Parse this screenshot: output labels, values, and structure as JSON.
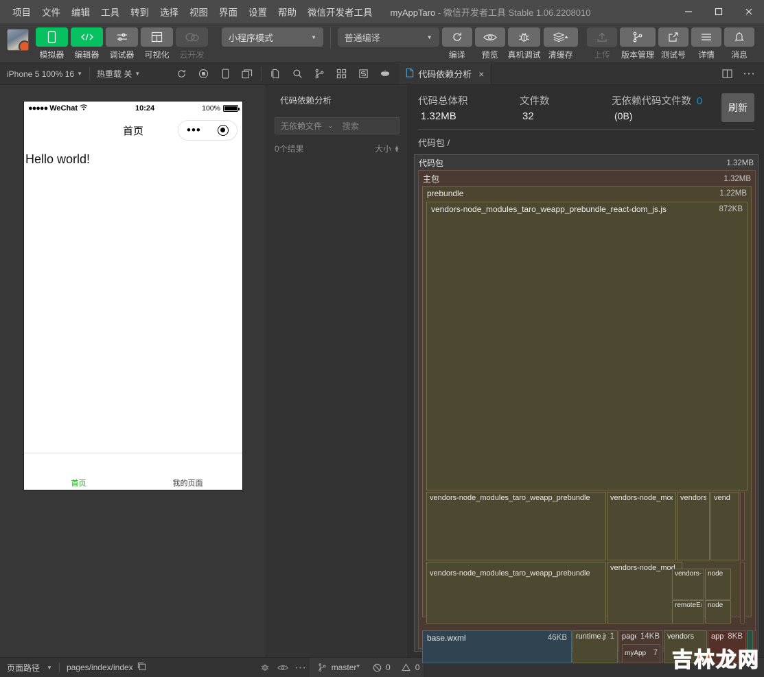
{
  "titlebar": {
    "menus": [
      "项目",
      "文件",
      "编辑",
      "工具",
      "转到",
      "选择",
      "视图",
      "界面",
      "设置",
      "帮助",
      "微信开发者工具"
    ],
    "project_name": "myAppTaro",
    "separator": "-",
    "app_name": "微信开发者工具",
    "version": "Stable 1.06.2208010",
    "window_controls": [
      "minimize-icon",
      "maximize-icon",
      "close-icon"
    ]
  },
  "toolbar": {
    "buttons": [
      {
        "label": "模拟器",
        "icon": "phone-icon",
        "state": "green"
      },
      {
        "label": "编辑器",
        "icon": "code-icon",
        "state": "green"
      },
      {
        "label": "调试器",
        "icon": "sliders-icon",
        "state": "normal"
      },
      {
        "label": "可视化",
        "icon": "layout-icon",
        "state": "normal"
      },
      {
        "label": "云开发",
        "icon": "cloud-icon",
        "state": "disabled"
      }
    ],
    "mode_select": "小程序模式",
    "compile_select": "普通编译",
    "actions": [
      {
        "label": "编译",
        "icon": "refresh-icon",
        "state": "normal"
      },
      {
        "label": "预览",
        "icon": "eye-icon",
        "state": "normal"
      },
      {
        "label": "真机调试",
        "icon": "bug-icon",
        "state": "normal"
      },
      {
        "label": "清缓存",
        "icon": "layers-icon",
        "state": "normal"
      },
      {
        "label": "上传",
        "icon": "upload-icon",
        "state": "disabled"
      },
      {
        "label": "版本管理",
        "icon": "branch-icon",
        "state": "normal"
      },
      {
        "label": "测试号",
        "icon": "external-link-icon",
        "state": "normal"
      },
      {
        "label": "详情",
        "icon": "menu-icon",
        "state": "normal"
      },
      {
        "label": "消息",
        "icon": "bell-icon",
        "state": "normal"
      }
    ]
  },
  "subbar": {
    "device": "iPhone 5 100% 16",
    "hot_reload": "热重载 关",
    "sim_icons": [
      "refresh-icon",
      "record-icon",
      "device-icon",
      "window-icon"
    ],
    "editor_icons": [
      "new-file-icon",
      "search-icon",
      "branch-icon",
      "extensions-icon",
      "simulate-icon",
      "pot-icon"
    ],
    "tab": {
      "label": "代码依赖分析",
      "icon": "file-icon",
      "close": "×"
    },
    "right_icons": [
      "split-editor-icon",
      "more-icon"
    ]
  },
  "simulator": {
    "status_carrier": "WeChat",
    "status_dots": "●●●●●",
    "wifi": "wifi-icon",
    "time": "10:24",
    "battery_text": "100%",
    "nav_title": "首页",
    "page_text": "Hello world!",
    "tabbar": [
      {
        "label": "首页",
        "active": true
      },
      {
        "label": "我的页面",
        "active": false
      }
    ]
  },
  "dependency_sidebar": {
    "title": "代码依赖分析",
    "filter_label": "无依赖文件",
    "search_placeholder": "搜索",
    "result_count": "0个结果",
    "sort_label": "大小"
  },
  "analysis": {
    "stats": [
      {
        "key": "代码总体积",
        "value": "1.32MB"
      },
      {
        "key": "文件数",
        "value": "32"
      }
    ],
    "no_dep": {
      "key": "无依赖代码文件数",
      "count": "0",
      "size": "(0B)"
    },
    "refresh_label": "刷新",
    "breadcrumb": "代码包 /"
  },
  "chart_data": {
    "type": "treemap",
    "title": "代码包 /",
    "total_size": "1.32MB",
    "file_count": 32,
    "nodes": [
      {
        "name": "代码包",
        "size": "1.32MB",
        "level": 0
      },
      {
        "name": "主包",
        "size": "1.32MB",
        "level": 1
      },
      {
        "name": "prebundle",
        "size": "1.22MB",
        "level": 2
      },
      {
        "name": "vendors-node_modules_taro_weapp_prebundle_react-dom_js.js",
        "size": "872KB",
        "level": 3
      },
      {
        "name": "vendors-node_modules_taro_weapp_prebundle",
        "size": "",
        "level": 3
      },
      {
        "name": "vendors-node_mod",
        "size": "",
        "level": 3
      },
      {
        "name": "vendors-",
        "size": "",
        "level": 3
      },
      {
        "name": "vend",
        "size": "",
        "level": 3
      },
      {
        "name": "vendors-node_modules_taro_weapp_prebundle",
        "size": "",
        "level": 3
      },
      {
        "name": "vendors-node_mod",
        "size": "",
        "level": 3
      },
      {
        "name": "vendors-",
        "size": "",
        "level": 3
      },
      {
        "name": "node",
        "size": "",
        "level": 3
      },
      {
        "name": "remoteEn",
        "size": "",
        "level": 3
      },
      {
        "name": "node",
        "size": "",
        "level": 3
      },
      {
        "name": "base.wxml",
        "size": "46KB",
        "level": 2
      },
      {
        "name": "runtime.js",
        "size": "1",
        "level": 2
      },
      {
        "name": "pages",
        "size": "14KB",
        "level": 2
      },
      {
        "name": "myApp",
        "size": "7",
        "level": 3
      },
      {
        "name": "vendors",
        "size": "",
        "level": 2
      },
      {
        "name": "app.js",
        "size": "8KB",
        "level": 2
      }
    ]
  },
  "statusbar": {
    "page_path_label": "页面路径",
    "page_path": "pages/index/index",
    "copy_icon": "copy-icon",
    "icons": [
      "bug-icon",
      "eye-icon",
      "more-icon"
    ],
    "branch": "master*",
    "errors": "0",
    "warnings": "0"
  },
  "watermark": "吉林龙网"
}
